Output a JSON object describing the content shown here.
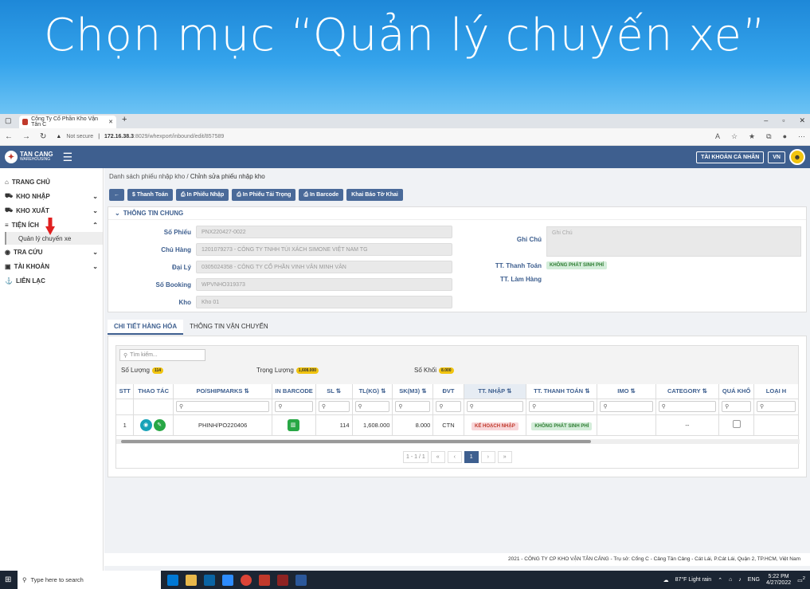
{
  "slide": {
    "title": "Chọn mục “Quản lý chuyến xe”"
  },
  "browser": {
    "tab_title": "Công Ty Cổ Phần Kho Vận Tân C",
    "new_tab": "+",
    "not_secure": "Not secure",
    "url_host": "172.16.38.3",
    "url_path": ":8029/whexport/inbound/edit/857589"
  },
  "app": {
    "logo_main": "TAN CANG",
    "logo_sub": "WAREHOUSING",
    "account_btn": "TÀI KHOẢN CÁ NHÂN",
    "lang_btn": "VN"
  },
  "sidebar": {
    "items": [
      {
        "label": "TRANG CHỦ",
        "icon": "home-icon",
        "glyph": "⌂"
      },
      {
        "label": "KHO NHẬP",
        "icon": "cart-icon",
        "glyph": "⛟",
        "chev": "⌄"
      },
      {
        "label": "KHO XUẤT",
        "icon": "cart-icon",
        "glyph": "⛟",
        "chev": "⌄"
      },
      {
        "label": "TIỆN ÍCH",
        "icon": "list-icon",
        "glyph": "≡",
        "chev": "⌃"
      },
      {
        "label": "TRA CỨU",
        "icon": "globe-icon",
        "glyph": "◉",
        "chev": "⌄"
      },
      {
        "label": "TÀI KHOẢN",
        "icon": "id-icon",
        "glyph": "▣",
        "chev": "⌄"
      },
      {
        "label": "LIÊN LẠC",
        "icon": "anchor-icon",
        "glyph": "⚓"
      }
    ],
    "sub_item": "Quản lý chuyến xe"
  },
  "breadcrumb": {
    "parent": "Danh sách phiếu nhập kho",
    "separator": "/",
    "current": "Chỉnh sửa phiếu nhập kho"
  },
  "actions": [
    "Thanh Toán",
    "In Phiếu Nhập",
    "In Phiếu Tải Trọng",
    "In Barcode",
    "Khai Báo Tờ Khai"
  ],
  "general": {
    "title": "THÔNG TIN CHUNG",
    "fields": [
      {
        "label": "Số Phiếu",
        "value": "PNX220427-0022"
      },
      {
        "label": "Chủ Hàng",
        "value": "1201079273 - CÔNG TY TNHH TÚI XÁCH SIMONE VIỆT NAM TG"
      },
      {
        "label": "Đại Lý",
        "value": "0305024358 - CÔNG TY CỔ PHẦN VINH VÂN MINH VÂN"
      },
      {
        "label": "Số Booking",
        "value": "WPVNHO319373"
      },
      {
        "label": "Kho",
        "value": "Kho 01"
      }
    ],
    "note_label": "Ghi Chú",
    "note_placeholder": "Ghi Chú",
    "payment_label": "TT. Thanh Toán",
    "payment_value": "KHÔNG PHÁT SINH PHÍ",
    "handling_label": "TT. Làm Hàng"
  },
  "tabs": [
    "CHI TIẾT HÀNG HÓA",
    "THÔNG TIN VẬN CHUYỂN"
  ],
  "grid": {
    "search_placeholder": "Tìm kiếm...",
    "sum_qty_label": "Số Lượng",
    "sum_qty": "114",
    "sum_weight_label": "Trọng Lượng",
    "sum_weight": "1,608.000",
    "sum_vol_label": "Số Khối",
    "sum_vol": "8.000",
    "headers": [
      "STT",
      "THAO TÁC",
      "PO/SHIPMARKS",
      "IN BARCODE",
      "SL",
      "TL(KG)",
      "SK(M3)",
      "ĐVT",
      "TT. NHẬP",
      "TT. THANH TOÁN",
      "IMO",
      "CATEGORY",
      "QUÁ KHỔ",
      "LOẠI H"
    ],
    "sort_icon": "⇅",
    "row": {
      "stt": "1",
      "po": "PHINH/PO220406",
      "sl": "114",
      "tl": "1,608.000",
      "sk": "8.000",
      "dvt": "CTN",
      "tt_nhap": "KẾ HOẠCH NHẬP",
      "tt_thanh_toan": "KHÔNG PHÁT SINH PHÍ",
      "category": "--"
    },
    "pager": {
      "range": "1 - 1 / 1",
      "page": "1"
    }
  },
  "footer": "2021 - CÔNG TY CP KHO VẬN TÂN CẢNG - Trụ sở: Cổng C - Cảng Tân Cảng - Cát Lái, P.Cát Lái, Quận 2, TP.HCM, Việt Nam",
  "taskbar": {
    "search_placeholder": "Type here to search",
    "weather": "87°F  Light rain",
    "lang": "ENG",
    "time": "5:22 PM",
    "date": "4/27/2022",
    "notif": "2"
  },
  "colors": {
    "appbar": "#3e5f8f",
    "accent": "#3e5f8f",
    "slide_bg": "#2a96e2"
  }
}
